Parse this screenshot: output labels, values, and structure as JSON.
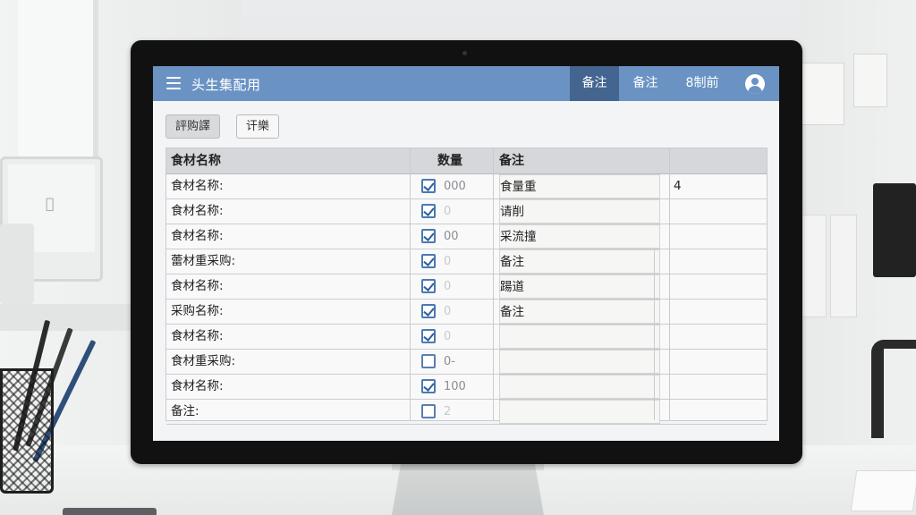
{
  "app": {
    "title": "头生集配用"
  },
  "nav": {
    "tabs": [
      {
        "label": "备注",
        "active": true
      },
      {
        "label": "备注",
        "active": false
      },
      {
        "label": "8制前",
        "active": false
      }
    ]
  },
  "toolbar": {
    "primary_label": "評购譯",
    "secondary_label": "讦樂"
  },
  "table": {
    "headers": {
      "name": "食材名称",
      "qty": "数量",
      "note": "备注"
    },
    "rows": [
      {
        "name": "食材名称:",
        "checked": true,
        "qty": "000",
        "note": "食量重",
        "extra": "4"
      },
      {
        "name": "食材名称:",
        "checked": true,
        "qty": "0",
        "note": "请削",
        "extra": ""
      },
      {
        "name": "食材名称:",
        "checked": true,
        "qty": "00",
        "note": "采流撞",
        "extra": ""
      },
      {
        "name": "蕾材重采购:",
        "checked": true,
        "qty": "0",
        "note": "备注",
        "extra": ""
      },
      {
        "name": "食材名称:",
        "checked": true,
        "qty": "0",
        "note": "踼道",
        "extra": ""
      },
      {
        "name": "采购名称:",
        "checked": true,
        "qty": "0",
        "note": "备注",
        "extra": ""
      },
      {
        "name": "食材名称:",
        "checked": true,
        "qty": "0",
        "note": "",
        "extra": ""
      },
      {
        "name": "食材重采购:",
        "checked": false,
        "qty": "0-",
        "note": "",
        "extra": ""
      },
      {
        "name": "食材名称:",
        "checked": true,
        "qty": "100",
        "note": "",
        "extra": ""
      },
      {
        "name": "备注:",
        "checked": false,
        "qty": "2",
        "note": "",
        "extra": ""
      }
    ]
  },
  "colors": {
    "header_bar": "#6a93c4",
    "active_tab": "#43658f",
    "checkbox": "#4a79b3"
  }
}
